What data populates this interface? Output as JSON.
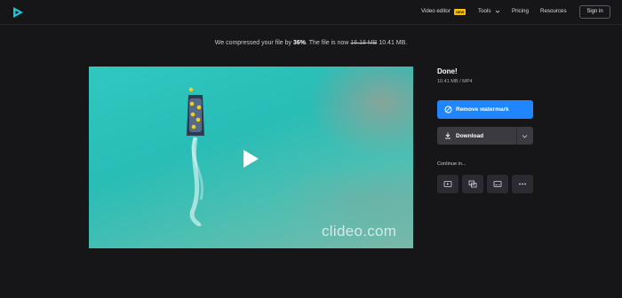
{
  "header": {
    "logo_icon": "clideo-play-logo-icon",
    "nav": {
      "video_editor": "Video editor",
      "new_badge": "NEW",
      "tools": "Tools",
      "pricing": "Pricing",
      "resources": "Resources"
    },
    "sign_in": "Sign in"
  },
  "banner": {
    "prefix": "We compressed your file by ",
    "percent": "36%",
    "middle": ". The file is now ",
    "old_size": "16.18 MB",
    "new_size": " 10.41 MB."
  },
  "video": {
    "watermark": "clideo.com",
    "play_icon": "play-icon"
  },
  "result": {
    "title": "Done!",
    "size": "10.41 MB",
    "separator": "/",
    "format": "MP4"
  },
  "actions": {
    "remove_watermark": "Remove watermark",
    "download": "Download"
  },
  "continue": {
    "label": "Continue in...",
    "tiles": [
      "video-player-icon",
      "merge-icon",
      "subtitles-icon",
      "more-icon"
    ]
  },
  "colors": {
    "background": "#161619",
    "accent": "#1f86ff",
    "logo": "#19c7d6",
    "badge": "#f5c000"
  }
}
